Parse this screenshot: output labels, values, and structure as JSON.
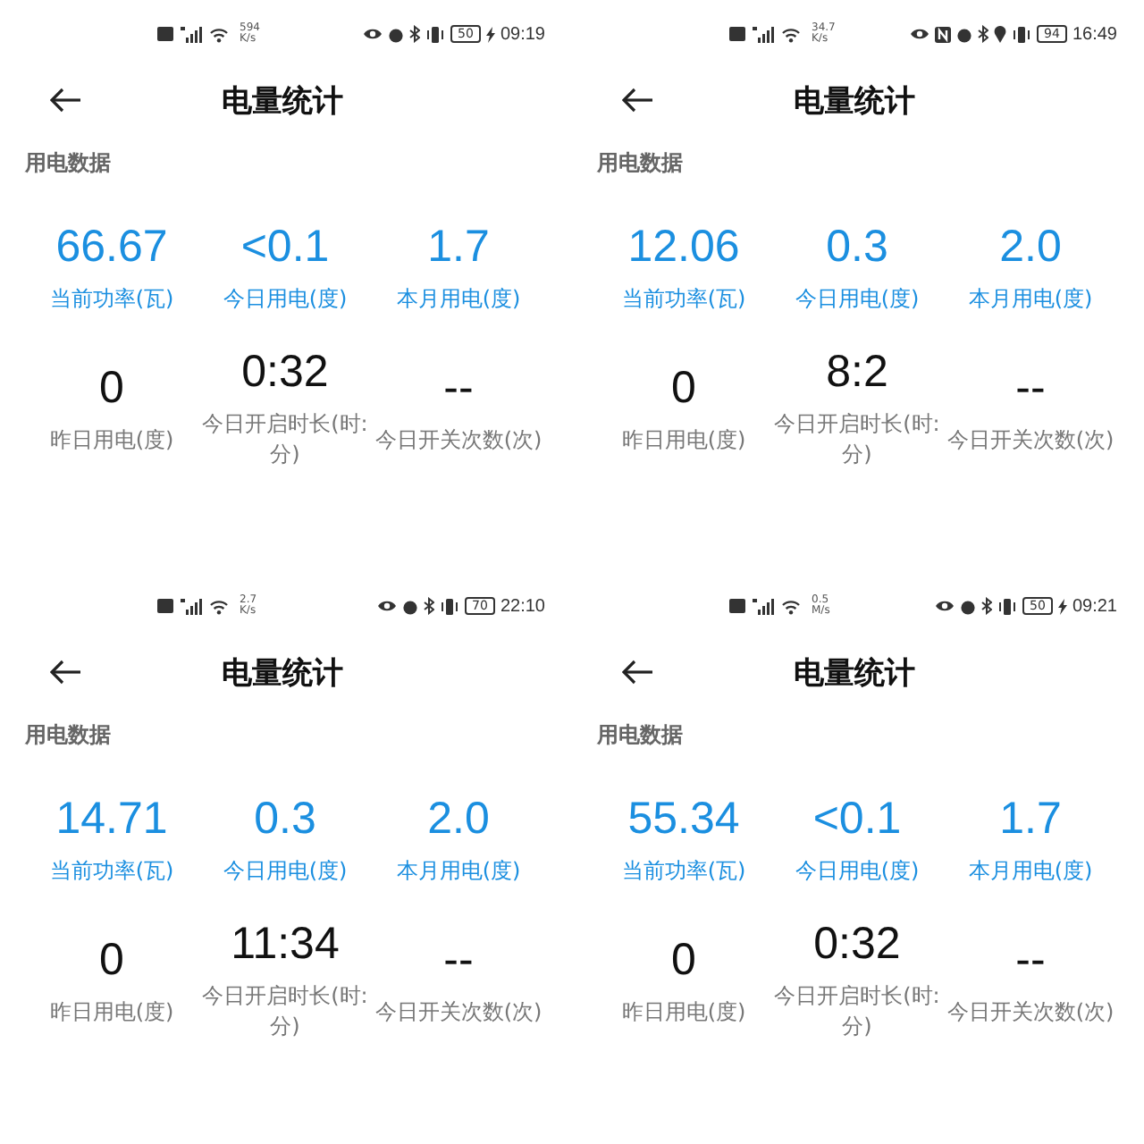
{
  "panels": [
    {
      "status": {
        "speed": "594",
        "speed_unit": "K/s",
        "nfc": false,
        "location": false,
        "battery": "50",
        "charging": true,
        "time": "09:19"
      },
      "title": "电量统计",
      "section": "用电数据",
      "rows": [
        {
          "kind": "primary",
          "cells": [
            {
              "value": "66.67",
              "label": "当前功率(瓦)"
            },
            {
              "value": "<0.1",
              "label": "今日用电(度)"
            },
            {
              "value": "1.7",
              "label": "本月用电(度)"
            }
          ]
        },
        {
          "kind": "secondary",
          "cells": [
            {
              "value": "0",
              "label": "昨日用电(度)"
            },
            {
              "value": "0:32",
              "label": "今日开启时长(时:分)"
            },
            {
              "value": "--",
              "label": "今日开关次数(次)"
            }
          ]
        }
      ]
    },
    {
      "status": {
        "speed": "34.7",
        "speed_unit": "K/s",
        "nfc": true,
        "location": true,
        "battery": "94",
        "charging": false,
        "time": "16:49"
      },
      "title": "电量统计",
      "section": "用电数据",
      "rows": [
        {
          "kind": "primary",
          "cells": [
            {
              "value": "12.06",
              "label": "当前功率(瓦)"
            },
            {
              "value": "0.3",
              "label": "今日用电(度)"
            },
            {
              "value": "2.0",
              "label": "本月用电(度)"
            }
          ]
        },
        {
          "kind": "secondary",
          "cells": [
            {
              "value": "0",
              "label": "昨日用电(度)"
            },
            {
              "value": "8:2",
              "label": "今日开启时长(时:分)"
            },
            {
              "value": "--",
              "label": "今日开关次数(次)"
            }
          ]
        }
      ]
    },
    {
      "status": {
        "speed": "2.7",
        "speed_unit": "K/s",
        "nfc": false,
        "location": false,
        "battery": "70",
        "charging": false,
        "time": "22:10"
      },
      "title": "电量统计",
      "section": "用电数据",
      "rows": [
        {
          "kind": "primary",
          "cells": [
            {
              "value": "14.71",
              "label": "当前功率(瓦)"
            },
            {
              "value": "0.3",
              "label": "今日用电(度)"
            },
            {
              "value": "2.0",
              "label": "本月用电(度)"
            }
          ]
        },
        {
          "kind": "secondary",
          "cells": [
            {
              "value": "0",
              "label": "昨日用电(度)"
            },
            {
              "value": "11:34",
              "label": "今日开启时长(时:分)"
            },
            {
              "value": "--",
              "label": "今日开关次数(次)"
            }
          ]
        }
      ]
    },
    {
      "status": {
        "speed": "0.5",
        "speed_unit": "M/s",
        "nfc": false,
        "location": false,
        "battery": "50",
        "charging": true,
        "time": "09:21"
      },
      "title": "电量统计",
      "section": "用电数据",
      "rows": [
        {
          "kind": "primary",
          "cells": [
            {
              "value": "55.34",
              "label": "当前功率(瓦)"
            },
            {
              "value": "<0.1",
              "label": "今日用电(度)"
            },
            {
              "value": "1.7",
              "label": "本月用电(度)"
            }
          ]
        },
        {
          "kind": "secondary",
          "cells": [
            {
              "value": "0",
              "label": "昨日用电(度)"
            },
            {
              "value": "0:32",
              "label": "今日开启时长(时:分)"
            },
            {
              "value": "--",
              "label": "今日开关次数(次)"
            }
          ]
        }
      ]
    }
  ]
}
